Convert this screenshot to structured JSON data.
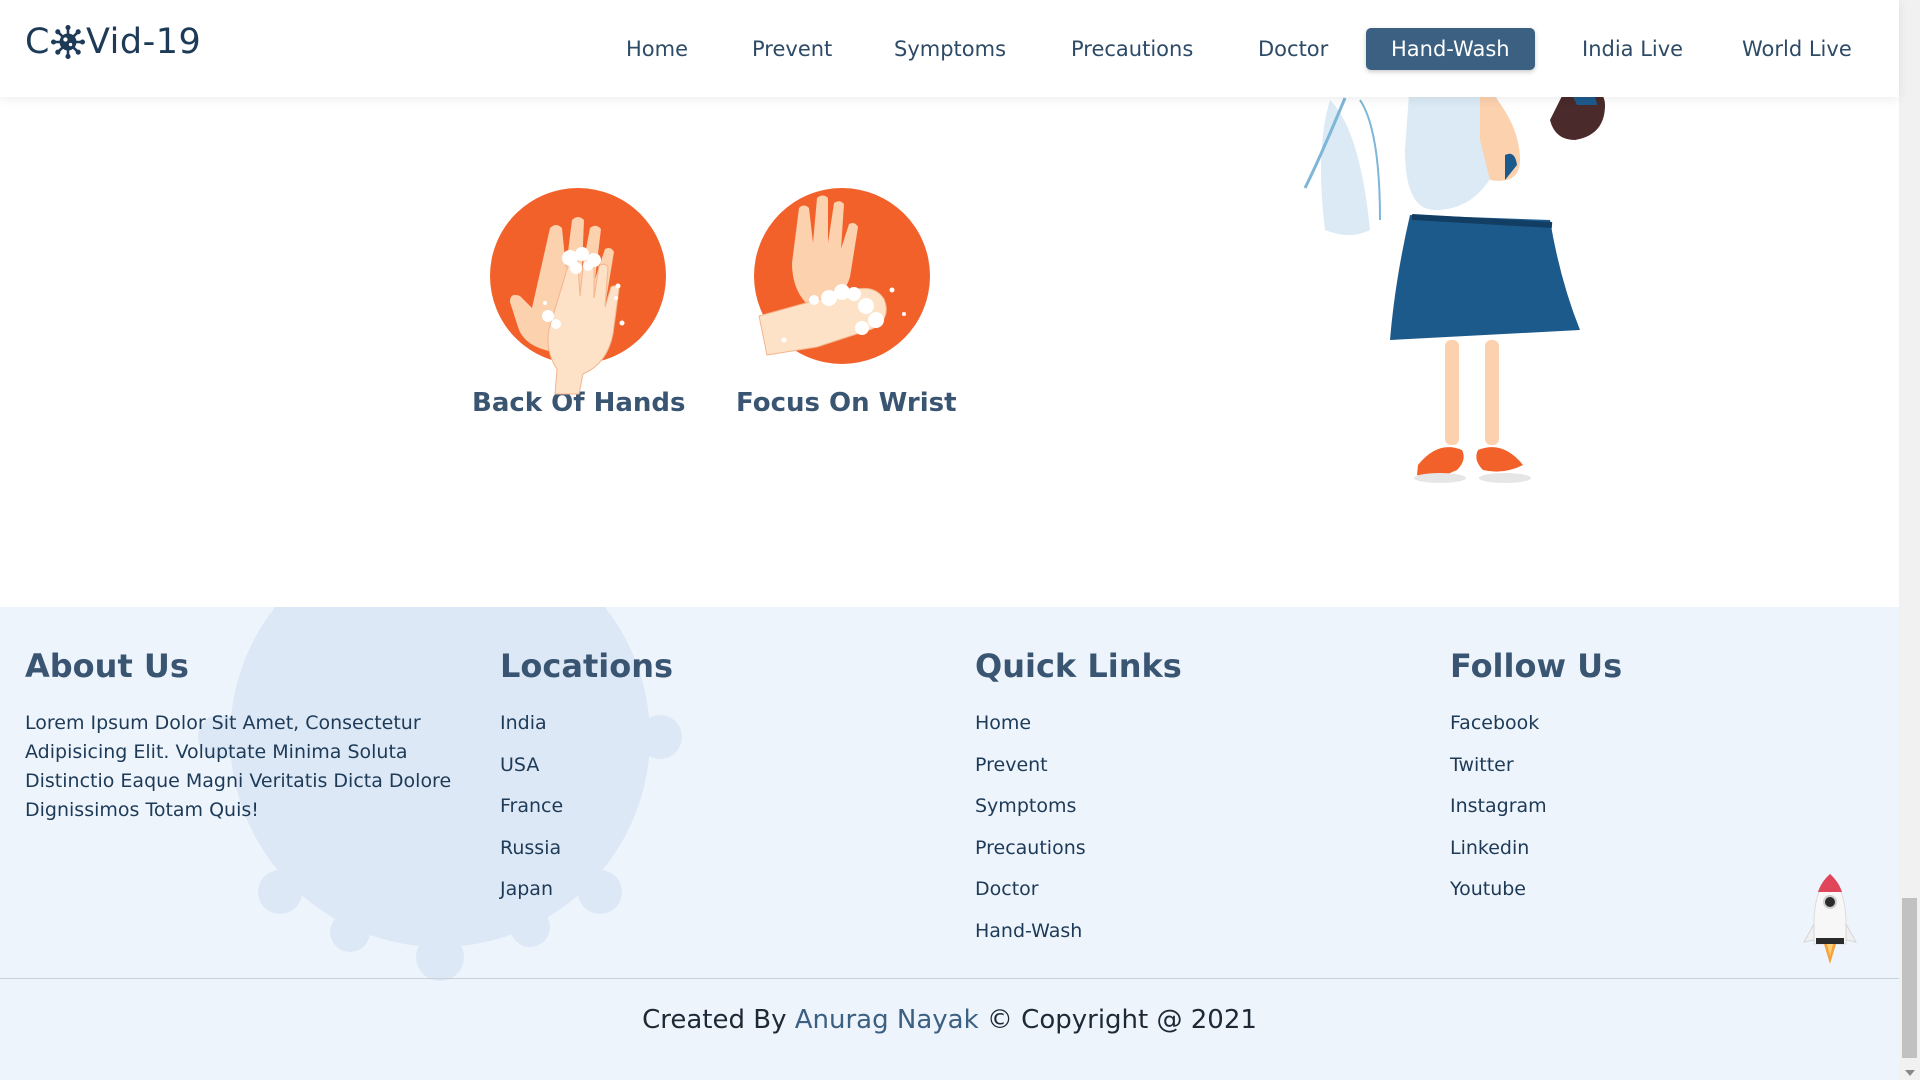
{
  "logo": {
    "text_before": "C",
    "text_after": "Vid-19",
    "icon": "virus-icon"
  },
  "nav": {
    "items": [
      {
        "label": "Home",
        "active": false
      },
      {
        "label": "Prevent",
        "active": false
      },
      {
        "label": "Symptoms",
        "active": false
      },
      {
        "label": "Precautions",
        "active": false
      },
      {
        "label": "Doctor",
        "active": false
      },
      {
        "label": "Hand-Wash",
        "active": true
      },
      {
        "label": "India Live",
        "active": false
      },
      {
        "label": "World Live",
        "active": false
      }
    ]
  },
  "steps": [
    {
      "label": "Back Of Hands",
      "icon": "hands-soap-icon"
    },
    {
      "label": "Focus On Wrist",
      "icon": "wrist-wash-icon"
    }
  ],
  "footer": {
    "about": {
      "heading": "About Us",
      "text": "Lorem Ipsum Dolor Sit Amet, Consectetur Adipisicing Elit. Voluptate Minima Soluta Distinctio Eaque Magni Veritatis Dicta Dolore Dignissimos Totam Quis!"
    },
    "locations": {
      "heading": "Locations",
      "items": [
        "India",
        "USA",
        "France",
        "Russia",
        "Japan"
      ]
    },
    "quick_links": {
      "heading": "Quick Links",
      "items": [
        "Home",
        "Prevent",
        "Symptoms",
        "Precautions",
        "Doctor",
        "Hand-Wash"
      ]
    },
    "follow": {
      "heading": "Follow Us",
      "items": [
        "Facebook",
        "Twitter",
        "Instagram",
        "Linkedin",
        "Youtube"
      ]
    },
    "credit": {
      "prefix": "Created By",
      "author": "Anurag Nayak",
      "suffix": "© Copyright @ 2021"
    }
  },
  "colors": {
    "accent": "#3b6082",
    "orange": "#f2612a",
    "footer_bg": "#eef4fc",
    "text": "#1d3a57"
  }
}
